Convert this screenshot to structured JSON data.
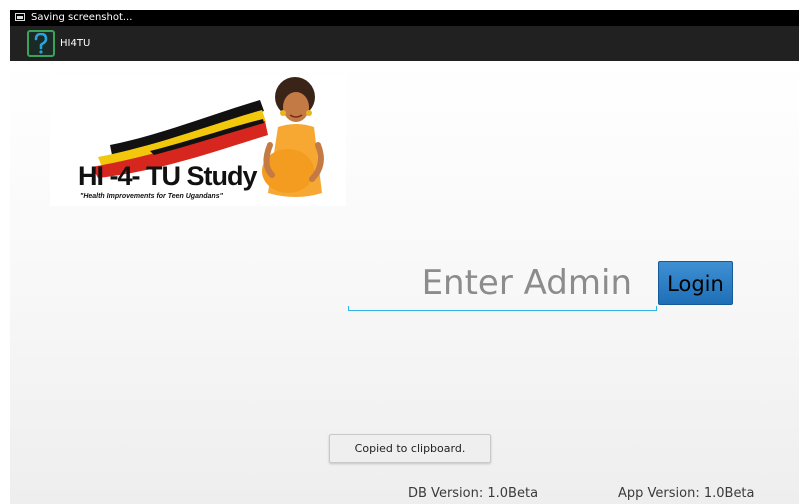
{
  "status_bar": {
    "notification_icon": "screenshot-icon",
    "text": "Saving screenshot..."
  },
  "action_bar": {
    "app_icon": "question-mark-app-icon",
    "title": "HI4TU"
  },
  "logo": {
    "title": "HI -4- TU Study",
    "subtitle": "\"Health Improvements for Teen Ugandans\"",
    "flag_colors": [
      "#111111",
      "#f2c80c",
      "#d7261e"
    ]
  },
  "admin_input": {
    "placeholder": "Enter Admin",
    "value": ""
  },
  "login_button": {
    "label": "Login"
  },
  "toast": {
    "text": "Copied to clipboard."
  },
  "footer": {
    "db_version": "DB Version: 1.0Beta",
    "app_version": "App Version: 1.0Beta"
  },
  "colors": {
    "accent": "#33b5e5",
    "button": "#2a7cc7",
    "action_bar": "#212121",
    "status_bar": "#000000"
  }
}
